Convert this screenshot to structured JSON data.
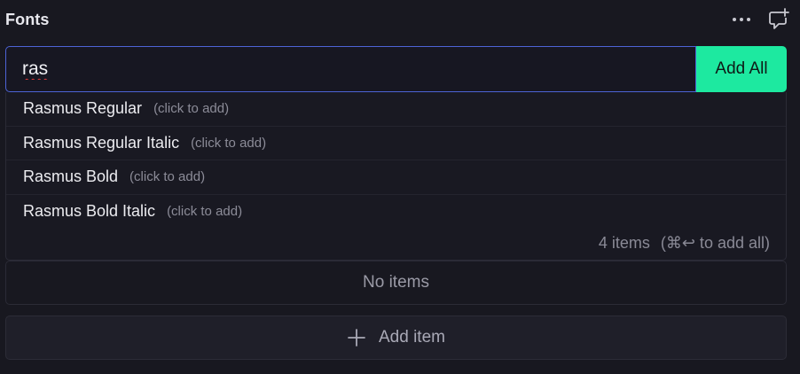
{
  "header": {
    "title": "Fonts",
    "more_icon": "more-horizontal-icon",
    "comment_icon": "comment-add-icon"
  },
  "search": {
    "value": "ras",
    "add_all_label": "Add All"
  },
  "suggestions": [
    {
      "name": "Rasmus Regular",
      "hint": "(click to add)"
    },
    {
      "name": "Rasmus Regular Italic",
      "hint": "(click to add)"
    },
    {
      "name": "Rasmus Bold",
      "hint": "(click to add)"
    },
    {
      "name": "Rasmus Bold Italic",
      "hint": "(click to add)"
    }
  ],
  "footer": {
    "count": "4 items",
    "shortcut": "(⌘↩ to add all)"
  },
  "list": {
    "empty_text": "No items"
  },
  "add_item": {
    "label": "Add item",
    "icon": "plus-icon"
  },
  "colors": {
    "accent_focus": "#4d63d6",
    "add_all_bg": "#1de9a0",
    "background": "#181820"
  }
}
